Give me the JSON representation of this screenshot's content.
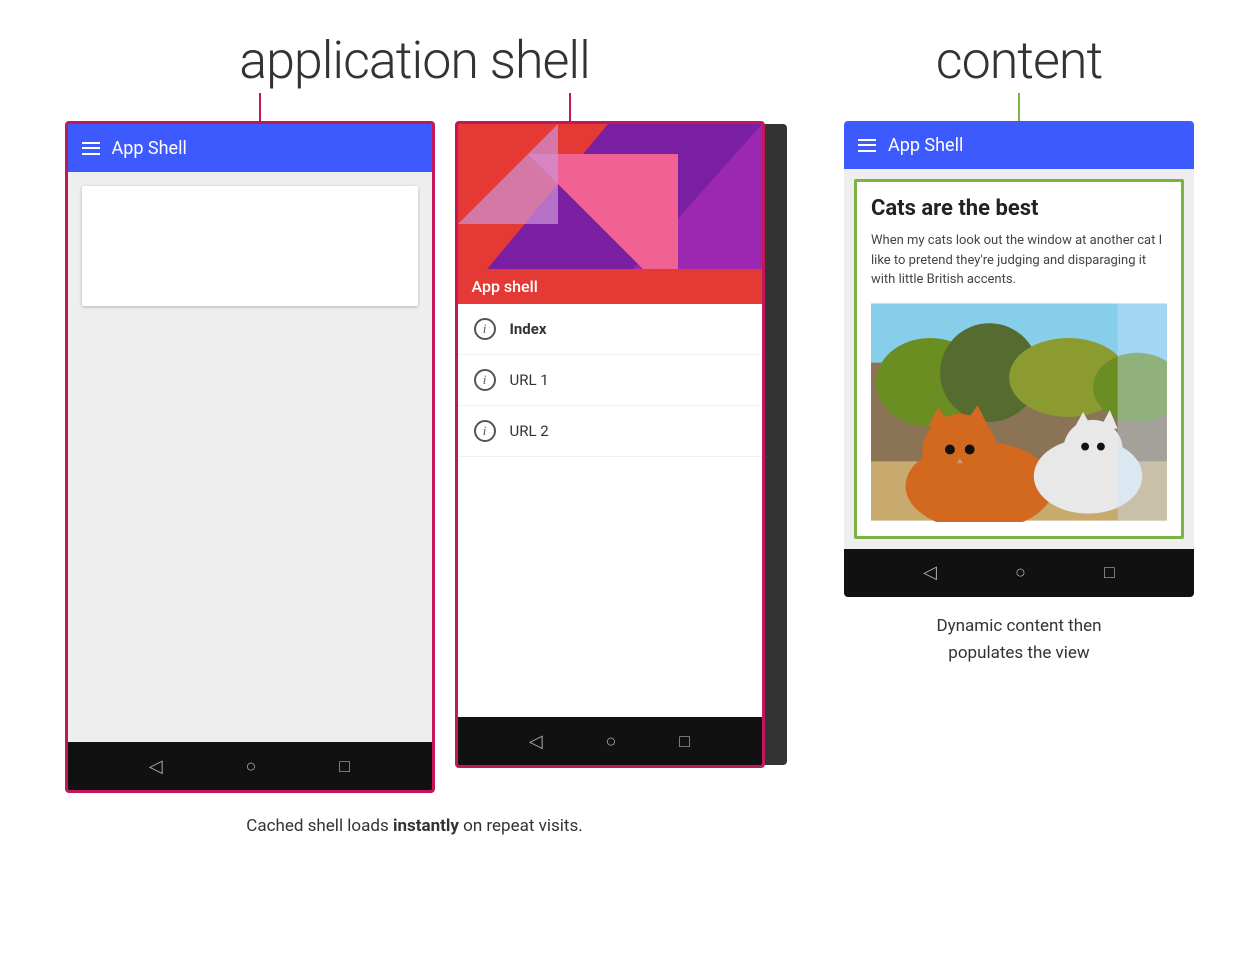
{
  "labels": {
    "application_shell": "application shell",
    "content": "content"
  },
  "phone1": {
    "title": "App Shell",
    "nav_back": "◁",
    "nav_home": "○",
    "nav_recent": "□"
  },
  "phone2": {
    "app_shell_label": "App shell",
    "drawer_items": [
      {
        "label": "Index",
        "bold": true
      },
      {
        "label": "URL 1",
        "bold": false
      },
      {
        "label": "URL 2",
        "bold": false
      }
    ],
    "nav_back": "◁",
    "nav_home": "○",
    "nav_recent": "□"
  },
  "phone3": {
    "title": "App Shell",
    "content_title": "Cats are the best",
    "content_desc": "When my cats look out the window at another cat I like to pretend they're judging and disparaging it with little British accents.",
    "nav_back": "◁",
    "nav_home": "○",
    "nav_recent": "□"
  },
  "captions": {
    "left": "Cached shell loads ",
    "left_bold": "instantly",
    "left_end": " on repeat visits.",
    "right_line1": "Dynamic content then",
    "right_line2": "populates the view"
  },
  "colors": {
    "pink_border": "#c2185b",
    "green_border": "#7cb342",
    "blue_header": "#3d5afe",
    "connector_pink": "#c2185b",
    "connector_green": "#7cb342"
  }
}
